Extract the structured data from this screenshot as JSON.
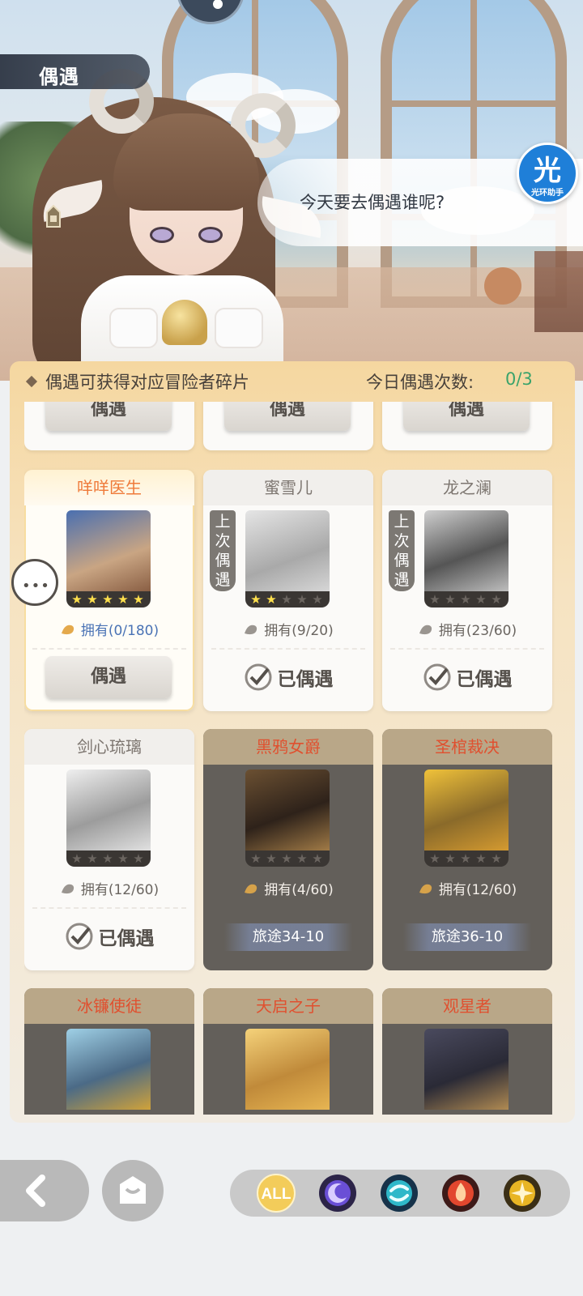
{
  "header": {
    "title": "偶遇"
  },
  "dialog": {
    "text": "今天要去偶遇谁呢?"
  },
  "helper": {
    "big": "光",
    "small": "光环助手"
  },
  "panel": {
    "hint": "偶遇可获得对应冒险者碎片",
    "count_label": "今日偶遇次数:",
    "count_value": "0/3"
  },
  "top_row_buttons": [
    "偶遇",
    "偶遇",
    "偶遇"
  ],
  "cards": [
    {
      "name": "咩咩医生",
      "stars": 5,
      "owned": "拥有(0/180)",
      "action": "偶遇",
      "state": "selected"
    },
    {
      "name": "蜜雪儿",
      "tag": "上次偶遇",
      "stars": 2,
      "owned": "拥有(9/20)",
      "action": "已偶遇",
      "state": "done"
    },
    {
      "name": "龙之澜",
      "tag": "上次偶遇",
      "stars": 0,
      "owned": "拥有(23/60)",
      "action": "已偶遇",
      "state": "done"
    },
    {
      "name": "剑心琉璃",
      "stars": 0,
      "owned": "拥有(12/60)",
      "action": "已偶遇",
      "state": "done"
    },
    {
      "name": "黑鸦女爵",
      "stars": 0,
      "owned": "拥有(4/60)",
      "action": "旅途34-10",
      "state": "locked"
    },
    {
      "name": "圣棺裁决",
      "stars": 0,
      "owned": "拥有(12/60)",
      "action": "旅途36-10",
      "state": "locked"
    },
    {
      "name": "冰镰使徒",
      "state": "locked"
    },
    {
      "name": "天启之子",
      "state": "locked"
    },
    {
      "name": "观星者",
      "state": "locked"
    }
  ],
  "filters": [
    {
      "label": "ALL",
      "icon": "all-filter-icon",
      "color": "#f3cc5a"
    },
    {
      "label": "",
      "icon": "moon-star-icon",
      "color": "#6a4fd6"
    },
    {
      "label": "",
      "icon": "wind-swirl-icon",
      "color": "#2fb8c9"
    },
    {
      "label": "",
      "icon": "flame-icon",
      "color": "#e2472e"
    },
    {
      "label": "",
      "icon": "sun-compass-icon",
      "color": "#e8b524"
    }
  ],
  "colors": {
    "accent": "#ef7a3a",
    "count": "#3aa36b",
    "stars": "#ffe04d"
  }
}
